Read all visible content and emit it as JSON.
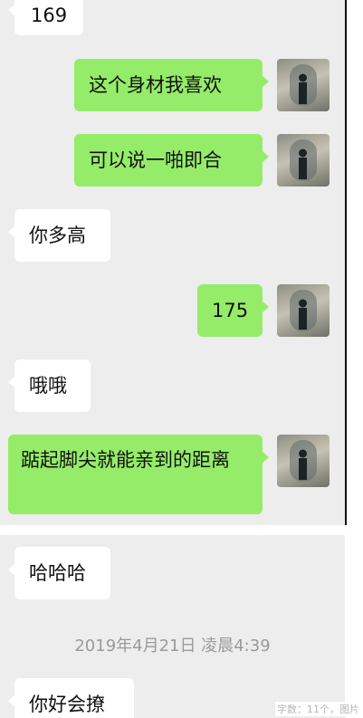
{
  "messages": [
    {
      "side": "in",
      "text": "169"
    },
    {
      "side": "out",
      "text": "这个身材我喜欢"
    },
    {
      "side": "out",
      "text": "可以说一啪即合"
    },
    {
      "side": "in",
      "text": "你多高"
    },
    {
      "side": "out",
      "text": "175"
    },
    {
      "side": "in",
      "text": "哦哦"
    },
    {
      "side": "out",
      "text": "踮起脚尖就能亲到的距离"
    },
    {
      "side": "in",
      "text": "哈哈哈"
    },
    {
      "side": "in",
      "text": "你好会撩"
    }
  ],
  "timestamp": "2019年4月21日 凌晨4:39",
  "watermark": "字数：11个，图片",
  "colors": {
    "chat_bg": "#ededed",
    "incoming_bubble": "#ffffff",
    "outgoing_bubble": "#95ec69",
    "timestamp_text": "#9a9a9a"
  },
  "avatar_icon": "photo-avatar-icon"
}
